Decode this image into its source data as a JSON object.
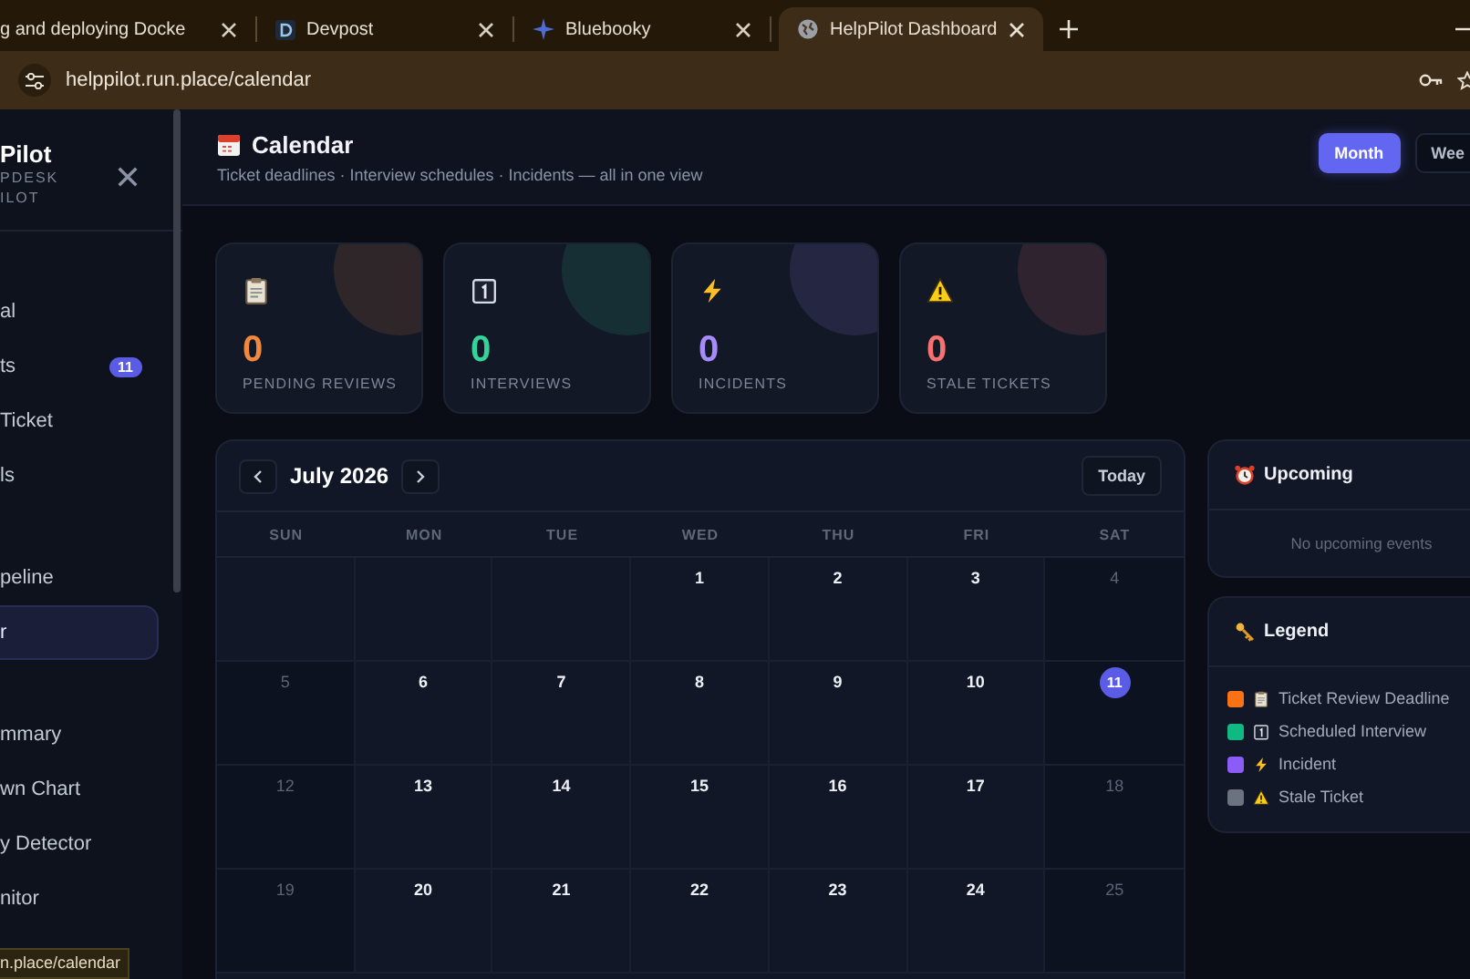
{
  "browser": {
    "tabs": [
      {
        "title": "g and deploying Docke",
        "kind": "doc",
        "selected": false
      },
      {
        "title": "Devpost",
        "kind": "devpost",
        "selected": false
      },
      {
        "title": "Bluebooky",
        "kind": "sparkle",
        "selected": false
      },
      {
        "title": "HelpPilot Dashboard",
        "kind": "globe",
        "selected": true
      }
    ],
    "address": "helppilot.run.place/calendar"
  },
  "sidebar": {
    "brand": "Pilot",
    "subtitle": [
      "PDESK",
      "ILOT"
    ],
    "groups": [
      {
        "items": [
          {
            "label": "al",
            "selected": false
          },
          {
            "label": "ts",
            "badge": "11",
            "selected": false
          },
          {
            "label": "Ticket",
            "selected": false
          },
          {
            "label": "ls",
            "selected": false
          }
        ]
      },
      {
        "items": [
          {
            "label": "peline",
            "selected": false
          },
          {
            "label": "r",
            "selected": true
          }
        ]
      },
      {
        "items": [
          {
            "label": "mmary",
            "selected": false
          },
          {
            "label": "wn Chart",
            "selected": false
          },
          {
            "label": "y Detector",
            "selected": false
          },
          {
            "label": "nitor",
            "selected": false
          }
        ]
      }
    ],
    "status_url": "n.place/calendar"
  },
  "header": {
    "title": "Calendar",
    "subtitle": "Ticket deadlines · Interview schedules · Incidents — all in one view",
    "views": [
      {
        "label": "Month",
        "selected": true
      },
      {
        "label": "Wee",
        "selected": false
      }
    ]
  },
  "stats": [
    {
      "kind": "clipboard",
      "value": "0",
      "label": "PENDING REVIEWS",
      "color": "#f0883e"
    },
    {
      "kind": "calendar-one",
      "value": "0",
      "label": "INTERVIEWS",
      "color": "#34d399"
    },
    {
      "kind": "lightning",
      "value": "0",
      "label": "INCIDENTS",
      "color": "#a78bfa"
    },
    {
      "kind": "warning",
      "value": "0",
      "label": "STALE TICKETS",
      "color": "#f87171"
    }
  ],
  "calendar": {
    "month": "July 2026",
    "today_button": "Today",
    "weekdays": [
      "SUN",
      "MON",
      "TUE",
      "WED",
      "THU",
      "FRI",
      "SAT"
    ],
    "weeks": [
      [
        {
          "kind": "empty"
        },
        {
          "kind": "empty"
        },
        {
          "kind": "empty"
        },
        {
          "kind": "day",
          "day": "1",
          "weekend": false,
          "today": false
        },
        {
          "kind": "day",
          "day": "2",
          "weekend": false,
          "today": false
        },
        {
          "kind": "day",
          "day": "3",
          "weekend": false,
          "today": false
        },
        {
          "kind": "day",
          "day": "4",
          "weekend": true,
          "today": false
        }
      ],
      [
        {
          "kind": "day",
          "day": "5",
          "weekend": true,
          "today": false
        },
        {
          "kind": "day",
          "day": "6",
          "weekend": false,
          "today": false
        },
        {
          "kind": "day",
          "day": "7",
          "weekend": false,
          "today": false
        },
        {
          "kind": "day",
          "day": "8",
          "weekend": false,
          "today": false
        },
        {
          "kind": "day",
          "day": "9",
          "weekend": false,
          "today": false
        },
        {
          "kind": "day",
          "day": "10",
          "weekend": false,
          "today": false
        },
        {
          "kind": "day",
          "day": "11",
          "weekend": true,
          "today": true
        }
      ],
      [
        {
          "kind": "day",
          "day": "12",
          "weekend": true,
          "today": false
        },
        {
          "kind": "day",
          "day": "13",
          "weekend": false,
          "today": false
        },
        {
          "kind": "day",
          "day": "14",
          "weekend": false,
          "today": false
        },
        {
          "kind": "day",
          "day": "15",
          "weekend": false,
          "today": false
        },
        {
          "kind": "day",
          "day": "16",
          "weekend": false,
          "today": false
        },
        {
          "kind": "day",
          "day": "17",
          "weekend": false,
          "today": false
        },
        {
          "kind": "day",
          "day": "18",
          "weekend": true,
          "today": false
        }
      ],
      [
        {
          "kind": "day",
          "day": "19",
          "weekend": true,
          "today": false
        },
        {
          "kind": "day",
          "day": "20",
          "weekend": false,
          "today": false
        },
        {
          "kind": "day",
          "day": "21",
          "weekend": false,
          "today": false
        },
        {
          "kind": "day",
          "day": "22",
          "weekend": false,
          "today": false
        },
        {
          "kind": "day",
          "day": "23",
          "weekend": false,
          "today": false
        },
        {
          "kind": "day",
          "day": "24",
          "weekend": false,
          "today": false
        },
        {
          "kind": "day",
          "day": "25",
          "weekend": true,
          "today": false
        }
      ]
    ]
  },
  "upcoming": {
    "title": "Upcoming",
    "empty_text": "No upcoming events"
  },
  "legend": {
    "title": "Legend",
    "items": [
      {
        "kind": "clipboard",
        "label": "Ticket Review Deadline",
        "color": "#f97316"
      },
      {
        "kind": "calendar-one",
        "label": "Scheduled Interview",
        "color": "#10b981"
      },
      {
        "kind": "lightning",
        "label": "Incident",
        "color": "#8b5cf6"
      },
      {
        "kind": "warning",
        "label": "Stale Ticket",
        "color": "#6b7280"
      }
    ]
  }
}
